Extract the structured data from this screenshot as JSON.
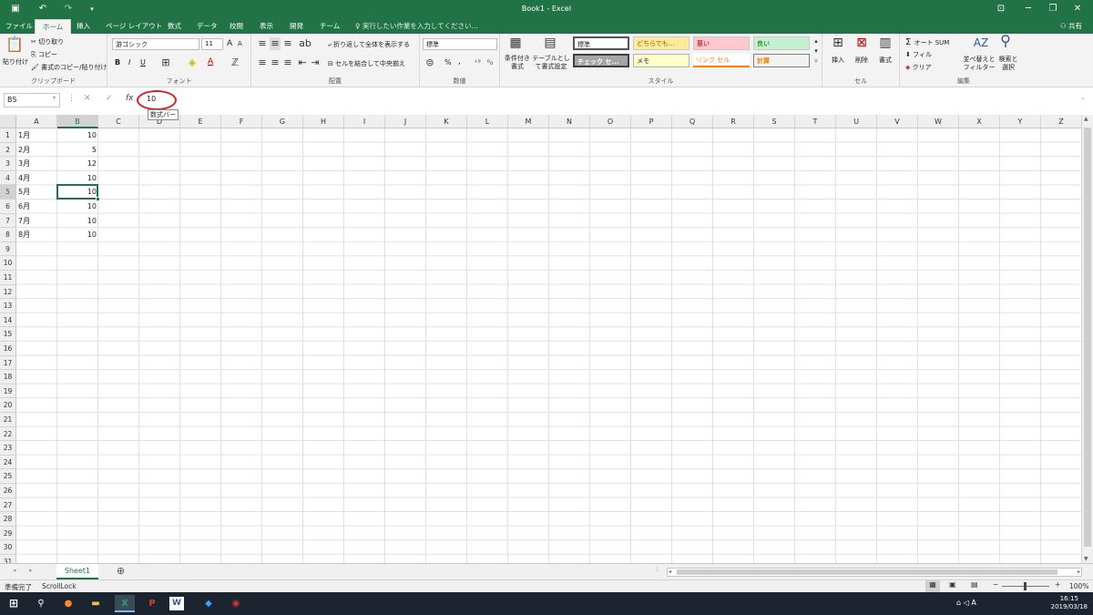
{
  "window": {
    "title": "Book1 - Excel",
    "share_label": "共有"
  },
  "ribbon_tabs": [
    "ファイル",
    "ホーム",
    "挿入",
    "ページ レイアウト",
    "数式",
    "データ",
    "校閲",
    "表示",
    "開発",
    "チーム"
  ],
  "tellme": "実行したい作業を入力してください...",
  "clipboard": {
    "paste": "貼り付け",
    "cut": "切り取り",
    "copy": "コピー",
    "format_painter": "書式のコピー/貼り付け",
    "group": "クリップボード"
  },
  "font": {
    "name": "游ゴシック",
    "size": "11",
    "bold": "B",
    "italic": "I",
    "underline": "U",
    "grow": "A",
    "shrink": "A",
    "color_a": "A",
    "group": "フォント"
  },
  "alignment": {
    "wrap": "折り返して全体を表示する",
    "merge": "セルを結合して中央揃え",
    "group": "配置"
  },
  "number": {
    "format": "標準",
    "percent": "%",
    "comma": ",",
    "group": "数値"
  },
  "styles": {
    "conditional": "条件付き書式",
    "table": "テーブルとして書式設定",
    "cells": [
      "標準",
      "どちらでも...",
      "悪い",
      "良い",
      "チェック セ...",
      "メモ",
      "リンク セル",
      "計算"
    ],
    "group": "スタイル"
  },
  "cells_group": {
    "insert": "挿入",
    "delete": "削除",
    "format": "書式",
    "group": "セル"
  },
  "editing": {
    "autosum": "オート SUM",
    "fill": "フィル",
    "clear": "クリア",
    "sort": "並べ替えとフィルター",
    "find": "検索と選択",
    "group": "編集"
  },
  "formula_bar": {
    "name_box": "B5",
    "fx": "fx",
    "value": "10",
    "tooltip": "数式バー"
  },
  "columns": [
    "A",
    "B",
    "C",
    "D",
    "E",
    "F",
    "G",
    "H",
    "I",
    "J",
    "K",
    "L",
    "M",
    "N",
    "O",
    "P",
    "Q",
    "R",
    "S",
    "T",
    "U",
    "V",
    "W",
    "X",
    "Y",
    "Z"
  ],
  "rows": [
    "1",
    "2",
    "3",
    "4",
    "5",
    "6",
    "7",
    "8",
    "9",
    "10",
    "11",
    "12",
    "13",
    "14",
    "15",
    "16",
    "17",
    "18",
    "19",
    "20",
    "21",
    "22",
    "23",
    "24",
    "25",
    "26",
    "27",
    "28",
    "29",
    "30",
    "31"
  ],
  "data": [
    [
      "1月",
      "10"
    ],
    [
      "2月",
      "5"
    ],
    [
      "3月",
      "12"
    ],
    [
      "4月",
      "10"
    ],
    [
      "5月",
      "10"
    ],
    [
      "6月",
      "10"
    ],
    [
      "7月",
      "10"
    ],
    [
      "8月",
      "10"
    ]
  ],
  "active_cell": {
    "col": "B",
    "row": "5"
  },
  "sheet": {
    "tab": "Sheet1"
  },
  "status": {
    "ready": "準備完了",
    "scroll": "ScrollLock",
    "zoom": "100%"
  },
  "taskbar": {
    "time": "16:15",
    "date": "2019/03/18"
  }
}
